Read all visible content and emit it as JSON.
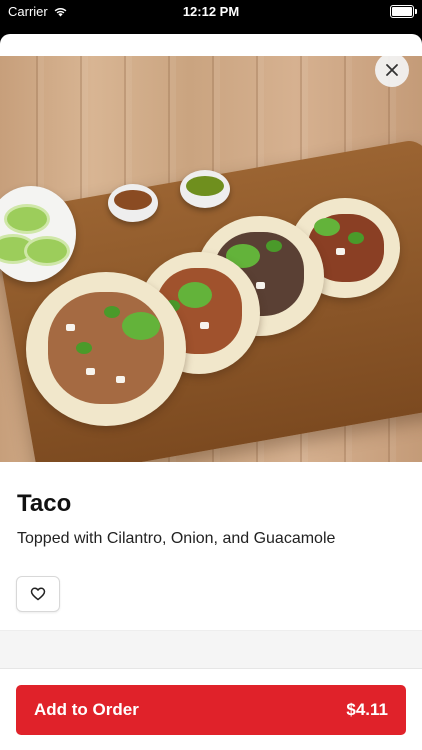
{
  "status_bar": {
    "carrier": "Carrier",
    "time": "12:12 PM"
  },
  "item": {
    "title": "Taco",
    "description": "Topped with Cilantro, Onion, and Guacamole"
  },
  "actions": {
    "add_to_order_label": "Add to Order",
    "price": "$4.11"
  },
  "icons": {
    "close": "close-icon",
    "favorite": "heart-icon",
    "wifi": "wifi-icon",
    "battery": "battery-icon"
  },
  "colors": {
    "accent": "#e0222a"
  }
}
